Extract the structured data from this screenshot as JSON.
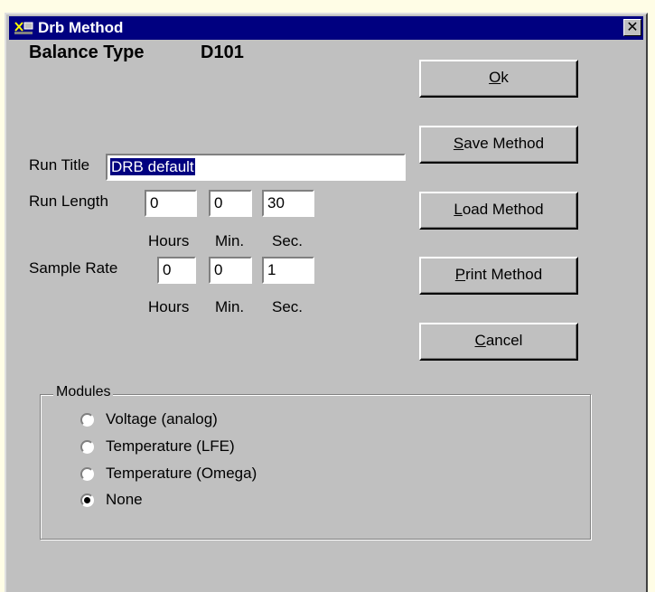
{
  "window": {
    "title": "Drb Method",
    "close_glyph": "✕",
    "icon": "balance-app-icon"
  },
  "balance": {
    "label": "Balance Type",
    "value": "D101"
  },
  "run_title": {
    "label": "Run Title",
    "value": "DRB default"
  },
  "run_length": {
    "label": "Run Length",
    "hours": "0",
    "min": "0",
    "sec": "30",
    "units": [
      "Hours",
      "Min.",
      "Sec."
    ]
  },
  "sample_rate": {
    "label": "Sample Rate",
    "hours": "0",
    "min": "0",
    "sec": "1",
    "units": [
      "Hours",
      "Min.",
      "Sec."
    ]
  },
  "buttons": {
    "ok": {
      "accel": "O",
      "rest": "k"
    },
    "save": {
      "accel": "S",
      "rest": "ave Method"
    },
    "load": {
      "accel": "L",
      "rest": "oad Method"
    },
    "print": {
      "accel": "P",
      "rest": "rint Method"
    },
    "cancel": {
      "accel": "C",
      "rest": "ancel"
    }
  },
  "modules": {
    "title": "Modules",
    "options": [
      {
        "label": "Voltage (analog)",
        "selected": false
      },
      {
        "label": "Temperature (LFE)",
        "selected": false
      },
      {
        "label": "Temperature (Omega)",
        "selected": false
      },
      {
        "label": "None",
        "selected": true
      }
    ]
  },
  "colors": {
    "titlebar": "#000080",
    "dialog_face": "#c0c0c0",
    "desktop": "#fffde6",
    "selection": "#000080"
  }
}
